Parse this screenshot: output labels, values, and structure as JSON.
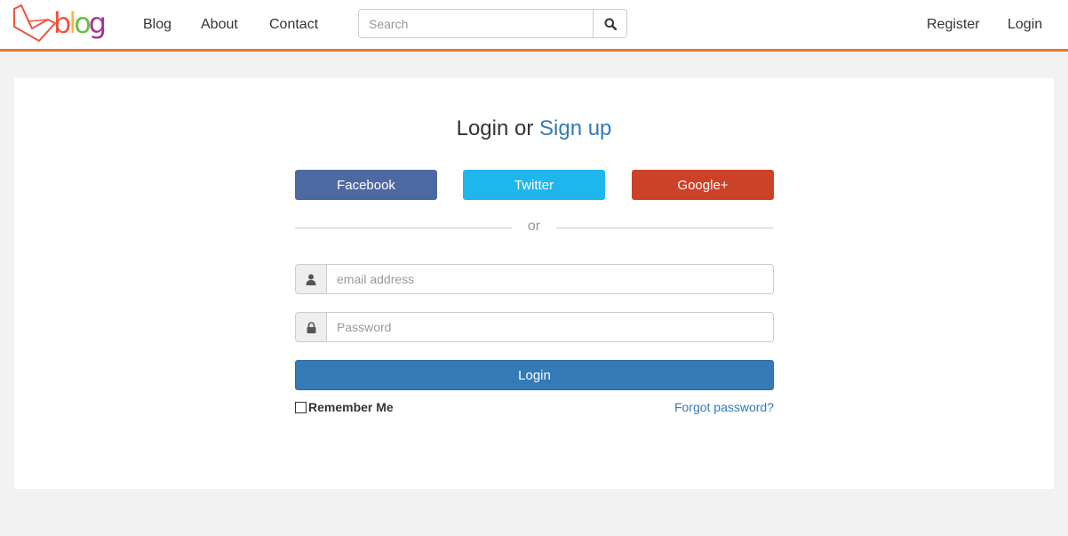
{
  "nav": {
    "logo_text": "blog",
    "links": [
      {
        "label": "Blog"
      },
      {
        "label": "About"
      },
      {
        "label": "Contact"
      }
    ],
    "right_links": [
      {
        "label": "Register"
      },
      {
        "label": "Login"
      }
    ],
    "search": {
      "placeholder": "Search",
      "value": ""
    }
  },
  "panel": {
    "heading_prefix": "Login or ",
    "heading_link": "Sign up",
    "social": {
      "facebook": "Facebook",
      "twitter": "Twitter",
      "google": "Google+"
    },
    "divider_text": "or",
    "email": {
      "placeholder": "email address",
      "value": ""
    },
    "password": {
      "placeholder": "Password",
      "value": ""
    },
    "login_button": "Login",
    "remember_label": "Remember Me",
    "forgot_link": "Forgot password?"
  },
  "colors": {
    "accent_border": "#e8752b",
    "primary": "#337ab7",
    "facebook": "#4e69a2",
    "twitter": "#1fb6ee",
    "google": "#cc4228"
  },
  "icons": {
    "search": "search-icon",
    "user": "user-icon",
    "lock": "lock-icon"
  }
}
